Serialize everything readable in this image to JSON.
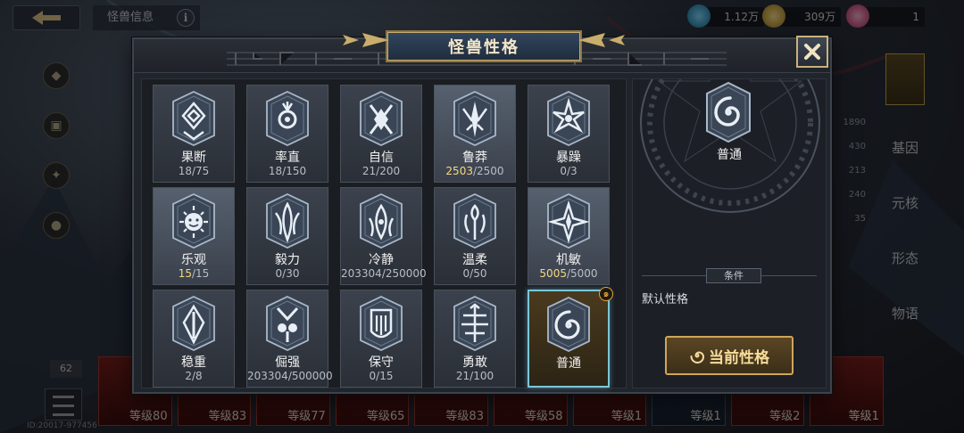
{
  "background": {
    "header_title": "怪兽信息",
    "currencies": [
      {
        "icon": "gem-icon",
        "value": "1.12万",
        "color": "#3fb3e0"
      },
      {
        "icon": "gold-icon",
        "value": "309万",
        "color": "#e2b640"
      },
      {
        "icon": "cloud-ticket-icon",
        "value": "1",
        "color": "#d95a8a"
      }
    ],
    "right_nav": [
      "基因",
      "元核",
      "形态",
      "物语"
    ],
    "stats": [
      "1890",
      "430",
      "213",
      "240",
      "35"
    ],
    "level_badge": "62",
    "cards": [
      {
        "level": "等级80"
      },
      {
        "level": "等级83"
      },
      {
        "level": "等级77"
      },
      {
        "level": "等级65"
      },
      {
        "level": "等级83"
      },
      {
        "level": "等级58"
      },
      {
        "level": "等级1"
      },
      {
        "level": "等级1"
      },
      {
        "level": "等级2"
      },
      {
        "level": "等级1"
      }
    ],
    "footer_id": "ID:20017-977456"
  },
  "modal": {
    "title": "怪兽性格",
    "personalities": [
      {
        "name": "果断",
        "current": "18",
        "max": "75",
        "state": "normal",
        "emblem": "decisive-emblem-icon"
      },
      {
        "name": "率直",
        "current": "18",
        "max": "150",
        "state": "normal",
        "emblem": "frank-emblem-icon"
      },
      {
        "name": "自信",
        "current": "21",
        "max": "200",
        "state": "normal",
        "emblem": "confident-emblem-icon"
      },
      {
        "name": "鲁莽",
        "current": "2503",
        "max": "2500",
        "state": "full",
        "emblem": "reckless-emblem-icon"
      },
      {
        "name": "暴躁",
        "current": "0",
        "max": "3",
        "state": "normal",
        "emblem": "irritable-emblem-icon"
      },
      {
        "name": "乐观",
        "current": "15",
        "max": "15",
        "state": "full",
        "emblem": "optimistic-emblem-icon"
      },
      {
        "name": "毅力",
        "current": "0",
        "max": "30",
        "state": "normal",
        "emblem": "perseverance-emblem-icon"
      },
      {
        "name": "冷静",
        "current": "203304",
        "max": "250000",
        "state": "normal",
        "emblem": "calm-emblem-icon"
      },
      {
        "name": "温柔",
        "current": "0",
        "max": "50",
        "state": "normal",
        "emblem": "gentle-emblem-icon"
      },
      {
        "name": "机敏",
        "current": "5005",
        "max": "5000",
        "state": "full",
        "emblem": "alert-emblem-icon"
      },
      {
        "name": "稳重",
        "current": "2",
        "max": "8",
        "state": "normal",
        "emblem": "steady-emblem-icon"
      },
      {
        "name": "倔强",
        "current": "203304",
        "max": "500000",
        "state": "normal",
        "emblem": "stubborn-emblem-icon"
      },
      {
        "name": "保守",
        "current": "0",
        "max": "15",
        "state": "normal",
        "emblem": "conservative-emblem-icon"
      },
      {
        "name": "勇敢",
        "current": "21",
        "max": "100",
        "state": "normal",
        "emblem": "brave-emblem-icon"
      },
      {
        "name": "普通",
        "current": "",
        "max": "",
        "state": "selected",
        "emblem": "spiral-emblem-icon"
      }
    ],
    "detail": {
      "name": "普通",
      "condition_label": "条件",
      "condition_text": "默认性格",
      "current_button": "当前性格"
    },
    "colors": {
      "accent_gold": "#d0a55a",
      "selected_border": "#7ac7d8",
      "full_value": "#f6d983"
    }
  }
}
